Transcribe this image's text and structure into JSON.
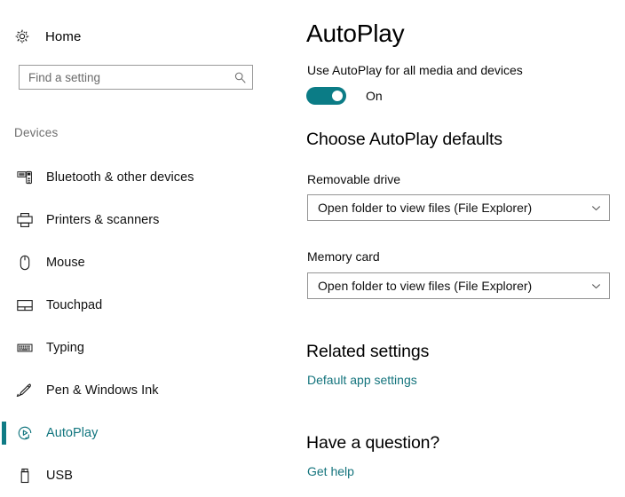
{
  "sidebar": {
    "home": {
      "label": "Home",
      "icon": "gear-icon"
    },
    "search": {
      "placeholder": "Find a setting",
      "value": "",
      "icon": "search-icon"
    },
    "group_label": "Devices",
    "items": [
      {
        "label": "Bluetooth & other devices",
        "icon": "bluetooth-device-icon",
        "selected": false
      },
      {
        "label": "Printers & scanners",
        "icon": "printer-icon",
        "selected": false
      },
      {
        "label": "Mouse",
        "icon": "mouse-icon",
        "selected": false
      },
      {
        "label": "Touchpad",
        "icon": "touchpad-icon",
        "selected": false
      },
      {
        "label": "Typing",
        "icon": "keyboard-icon",
        "selected": false
      },
      {
        "label": "Pen & Windows Ink",
        "icon": "pen-icon",
        "selected": false
      },
      {
        "label": "AutoPlay",
        "icon": "autoplay-icon",
        "selected": true
      },
      {
        "label": "USB",
        "icon": "usb-icon",
        "selected": false
      }
    ]
  },
  "main": {
    "title": "AutoPlay",
    "toggle": {
      "caption": "Use AutoPlay for all media and devices",
      "state_label": "On",
      "checked": true
    },
    "defaults_heading": "Choose AutoPlay defaults",
    "fields": [
      {
        "label": "Removable drive",
        "value": "Open folder to view files (File Explorer)"
      },
      {
        "label": "Memory card",
        "value": "Open folder to view files (File Explorer)"
      }
    ],
    "related": {
      "heading": "Related settings",
      "link": "Default app settings"
    },
    "question": {
      "heading": "Have a question?",
      "link": "Get help"
    }
  },
  "colors": {
    "accent": "#0b7c86",
    "link": "#14747d",
    "selected_text": "#11757e",
    "border": "#949494"
  }
}
